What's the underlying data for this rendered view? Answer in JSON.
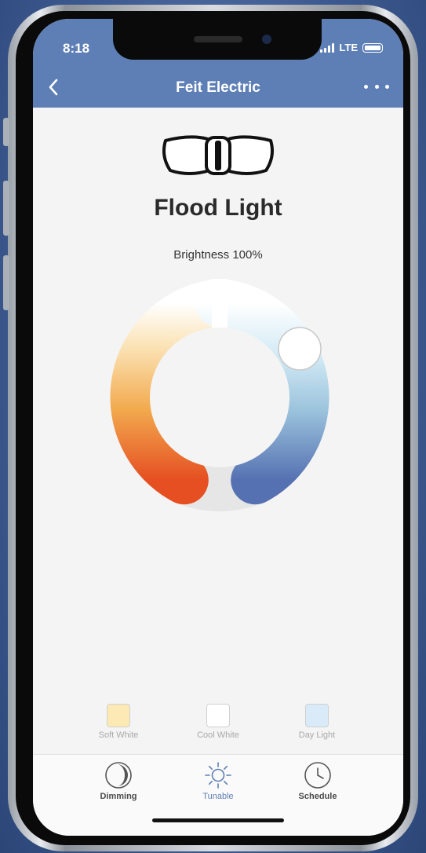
{
  "status_bar": {
    "time": "8:18",
    "network": "LTE"
  },
  "nav": {
    "title": "Feit Electric"
  },
  "device": {
    "name": "Flood Light",
    "icon": "flood-light-icon"
  },
  "brightness_label": "Brightness 100%",
  "color_wheel": {
    "selected_position": "cool-white"
  },
  "presets": [
    {
      "label": "Soft White",
      "color": "#fde9b4"
    },
    {
      "label": "Cool White",
      "color": "#ffffff"
    },
    {
      "label": "Day Light",
      "color": "#d9ebf8"
    }
  ],
  "tabs": [
    {
      "label": "Dimming",
      "icon": "dimming-moon-icon",
      "active": false
    },
    {
      "label": "Tunable",
      "icon": "sun-icon",
      "active": true
    },
    {
      "label": "Schedule",
      "icon": "clock-icon",
      "active": false
    }
  ],
  "colors": {
    "accent": "#5e7fb6",
    "warm": "#e8592a",
    "cool": "#5e7fb6"
  }
}
